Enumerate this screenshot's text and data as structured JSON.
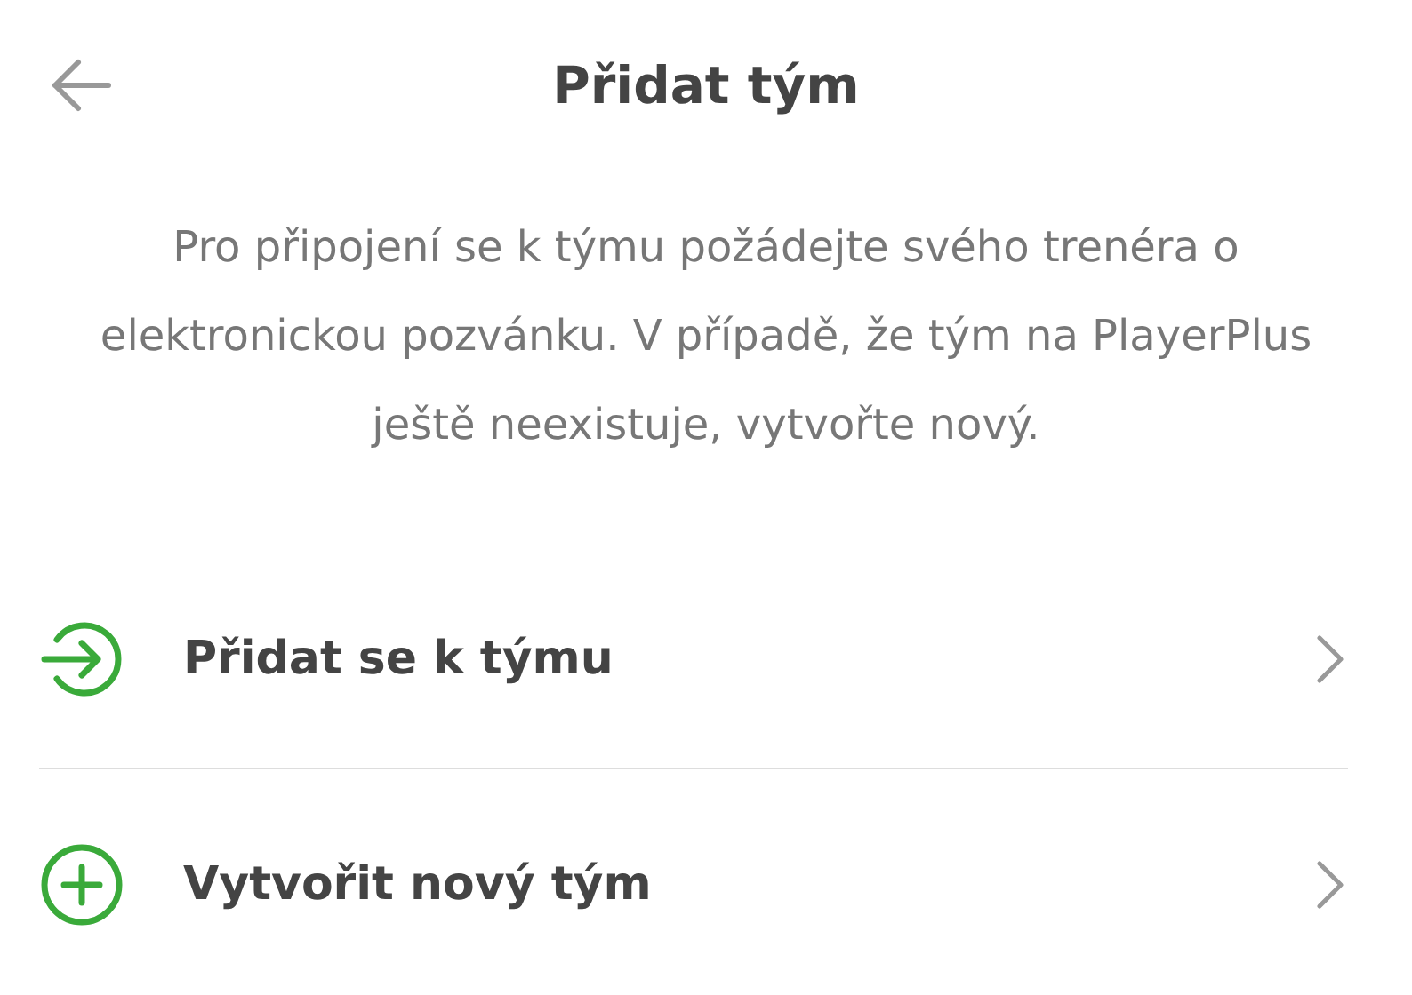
{
  "header": {
    "title": "Přidat tým"
  },
  "description": "Pro připojení se k týmu požádejte svého trenéra o elektronickou pozvánku. V případě, že tým na PlayerPlus ještě neexistuje, vytvořte nový.",
  "options": [
    {
      "kind": "join",
      "label": "Přidat se k týmu"
    },
    {
      "kind": "create",
      "label": "Vytvořit nový tým"
    }
  ]
}
